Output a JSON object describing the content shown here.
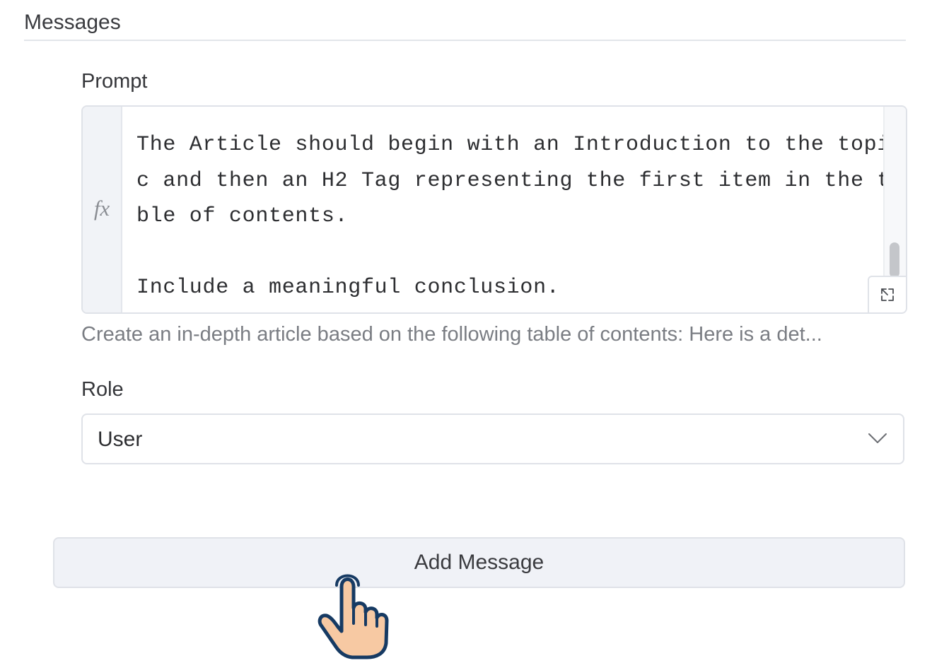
{
  "section": {
    "title": "Messages"
  },
  "prompt": {
    "label": "Prompt",
    "gutter_symbol": "fx",
    "text": "The Article should begin with an Introduction to the topi\nc and then an H2 Tag representing the first item in the ta\nble of contents.\n\nInclude a meaningful conclusion.",
    "helper_text": "Create an in-depth article based on the following table of contents: Here is a det...",
    "expand_icon": "expand-icon"
  },
  "role": {
    "label": "Role",
    "selected": "User",
    "dropdown_icon": "chevron-down-icon"
  },
  "actions": {
    "add_message_label": "Add Message"
  },
  "cursor": {
    "icon": "hand-pointer-icon"
  },
  "colors": {
    "border": "#dfe2e8",
    "gutter_bg": "#f1f3f7",
    "button_bg": "#f0f2f7",
    "helper_text": "#7a7d83",
    "cursor_outline": "#163a63",
    "cursor_skin": "#f7c9a3"
  }
}
